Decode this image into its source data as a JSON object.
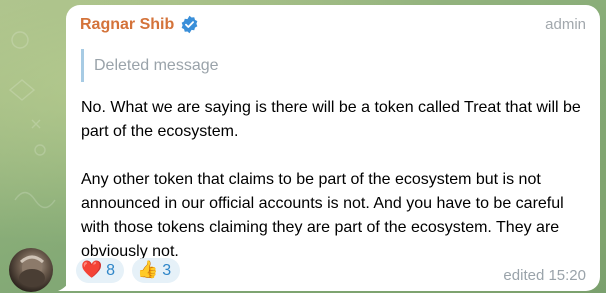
{
  "chat": {
    "sender_name": "Ragnar Shib",
    "sender_role": "admin",
    "verified_icon": "verified-badge-icon",
    "reply_preview": "Deleted message",
    "message_text": "No. What we are saying is there will be a token called Treat that will be part of the ecosystem.\n\nAny other token that claims to be part of the ecosystem but is not announced in our official accounts is not. And you have to be careful with those tokens claiming they are part of the ecosystem. They are obviously not.",
    "reactions": [
      {
        "emoji": "❤️",
        "icon": "red-heart-icon",
        "count": "8"
      },
      {
        "emoji": "👍",
        "icon": "thumbs-up-icon",
        "count": "3"
      }
    ],
    "meta": "edited 15:20"
  },
  "colors": {
    "sender": "#d4733a",
    "reply_bar": "#a7cbe4",
    "reaction_bg": "#e6f1f8",
    "reaction_count": "#2f86c8",
    "verified": "#3a8fd9"
  }
}
